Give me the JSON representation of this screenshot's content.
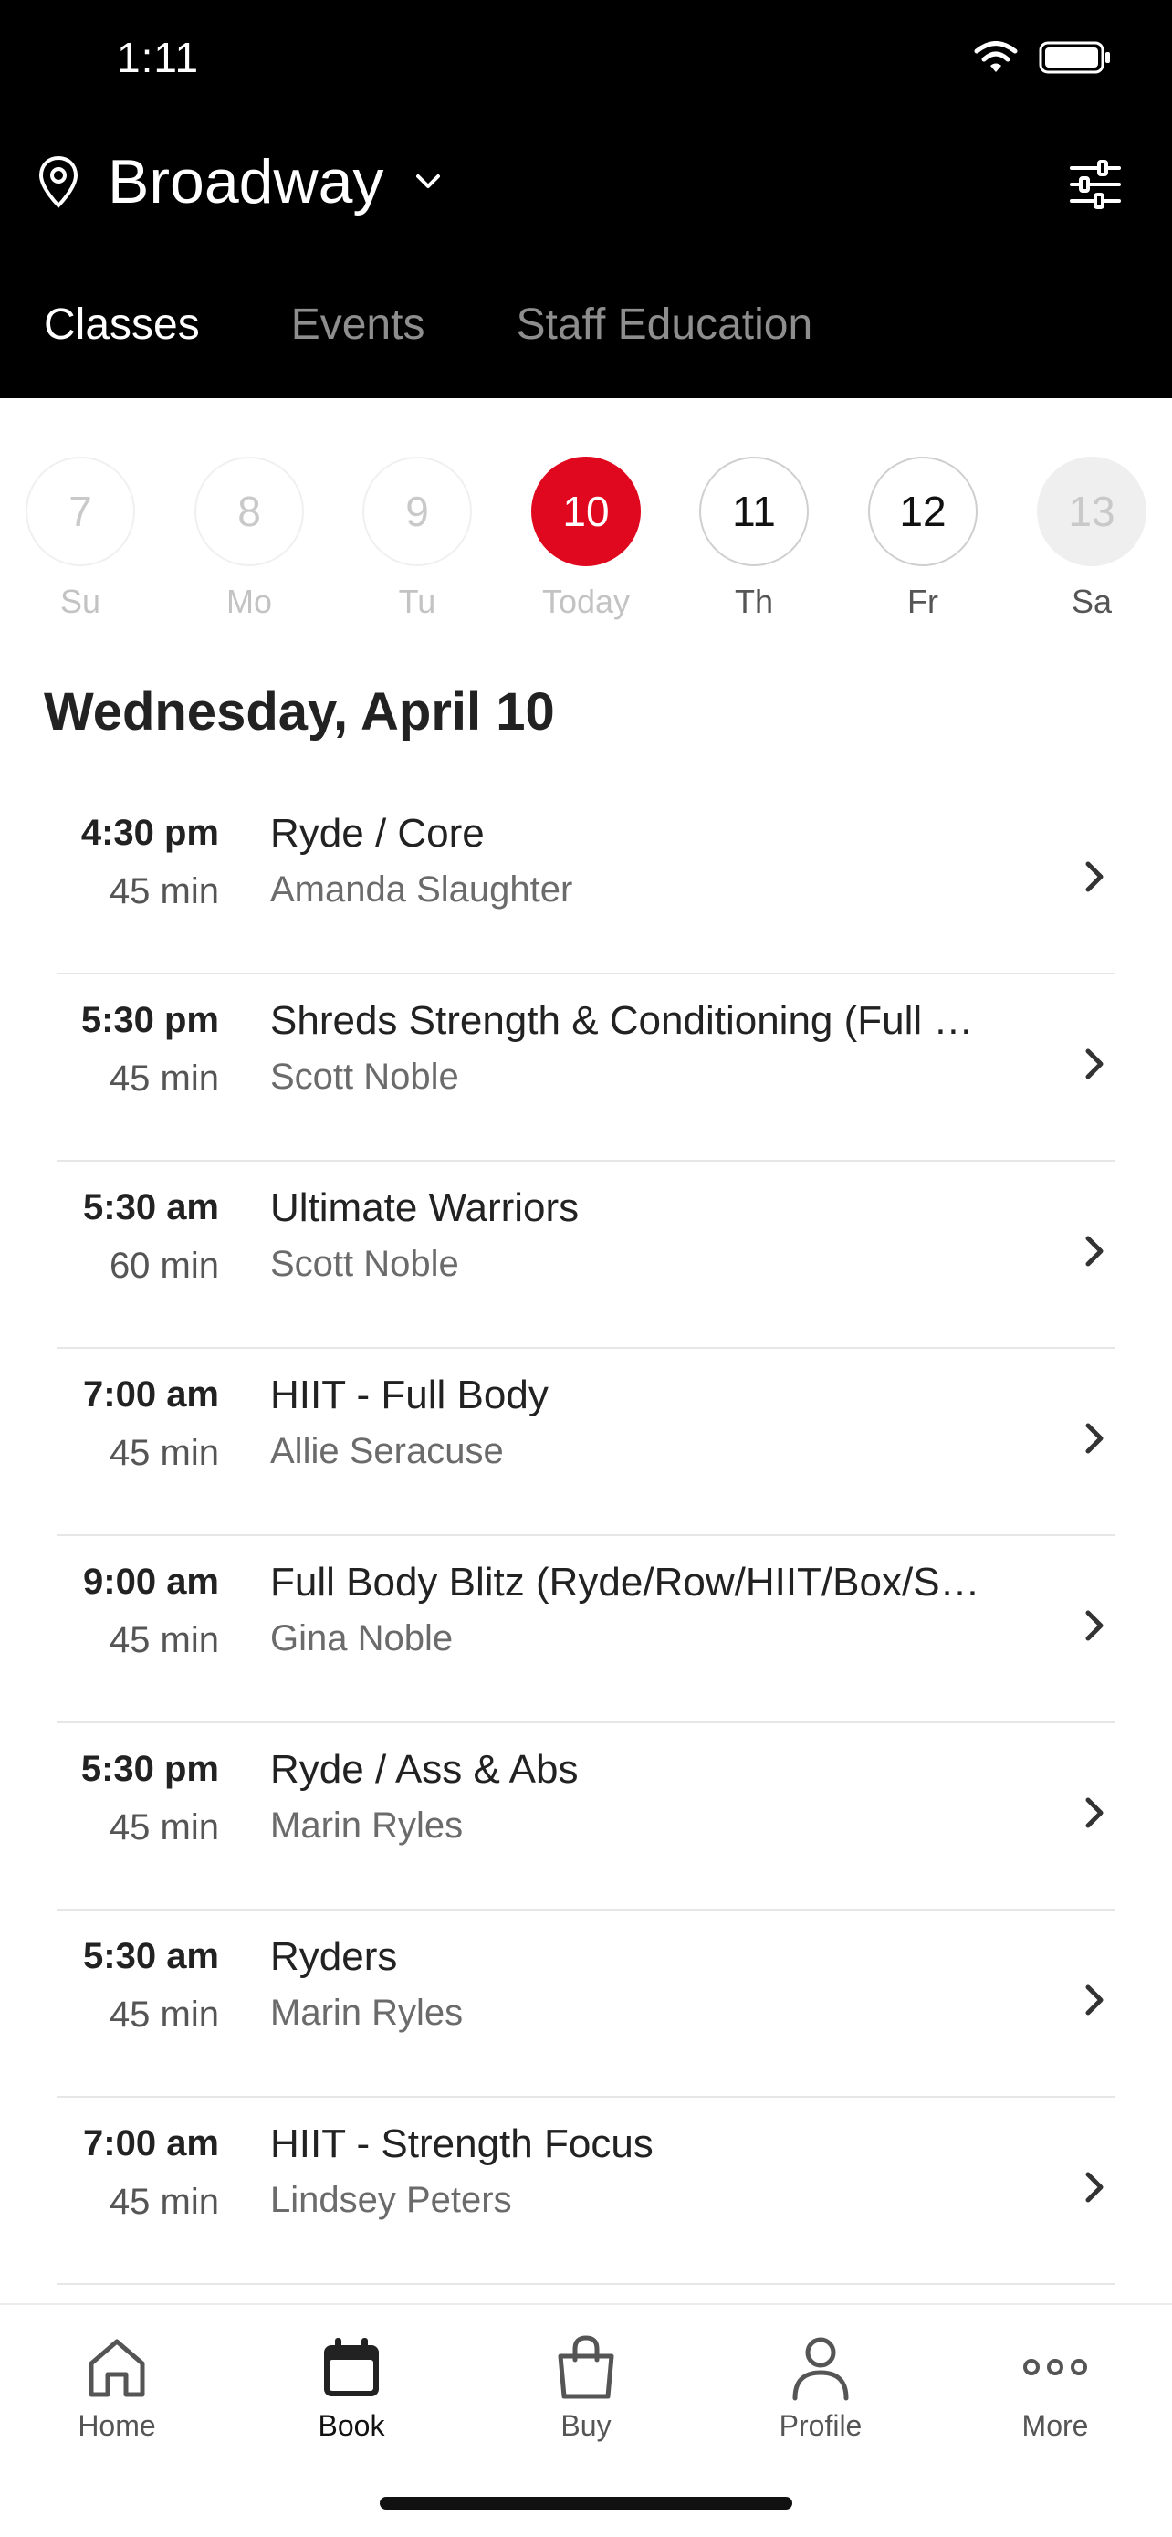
{
  "status_bar": {
    "time": "1:11"
  },
  "header": {
    "location": "Broadway",
    "tabs": [
      {
        "label": "Classes",
        "active": true
      },
      {
        "label": "Events",
        "active": false
      },
      {
        "label": "Staff Education",
        "active": false
      }
    ]
  },
  "week": [
    {
      "number": "7",
      "label": "Su",
      "state": "past"
    },
    {
      "number": "8",
      "label": "Mo",
      "state": "past"
    },
    {
      "number": "9",
      "label": "Tu",
      "state": "past"
    },
    {
      "number": "10",
      "label": "Today",
      "state": "selected"
    },
    {
      "number": "11",
      "label": "Th",
      "state": "future"
    },
    {
      "number": "12",
      "label": "Fr",
      "state": "future"
    },
    {
      "number": "13",
      "label": "Sa",
      "state": "disabled"
    }
  ],
  "date_heading": "Wednesday, April 10",
  "classes": [
    {
      "time": "4:30 pm",
      "duration": "45 min",
      "name": "Ryde / Core",
      "instructor": "Amanda Slaughter"
    },
    {
      "time": "5:30 pm",
      "duration": "45 min",
      "name": "Shreds Strength & Conditioning (Full …",
      "instructor": "Scott Noble"
    },
    {
      "time": "5:30 am",
      "duration": "60 min",
      "name": "Ultimate Warriors",
      "instructor": "Scott Noble"
    },
    {
      "time": "7:00 am",
      "duration": "45 min",
      "name": "HIIT - Full Body",
      "instructor": "Allie Seracuse"
    },
    {
      "time": "9:00 am",
      "duration": "45 min",
      "name": "Full Body Blitz (Ryde/Row/HIIT/Box/S…",
      "instructor": "Gina Noble"
    },
    {
      "time": "5:30 pm",
      "duration": "45 min",
      "name": "Ryde / Ass & Abs",
      "instructor": "Marin Ryles"
    },
    {
      "time": "5:30 am",
      "duration": "45 min",
      "name": "Ryders",
      "instructor": "Marin Ryles"
    },
    {
      "time": "7:00 am",
      "duration": "45 min",
      "name": "HIIT - Strength Focus",
      "instructor": "Lindsey Peters"
    }
  ],
  "bottom_nav": [
    {
      "label": "Home",
      "icon": "home-icon",
      "active": false
    },
    {
      "label": "Book",
      "icon": "calendar-icon",
      "active": true
    },
    {
      "label": "Buy",
      "icon": "shopping-bag-icon",
      "active": false
    },
    {
      "label": "Profile",
      "icon": "person-icon",
      "active": false
    },
    {
      "label": "More",
      "icon": "more-dots-icon",
      "active": false
    }
  ],
  "colors": {
    "accent": "#e0081e",
    "header_bg": "#000000"
  }
}
